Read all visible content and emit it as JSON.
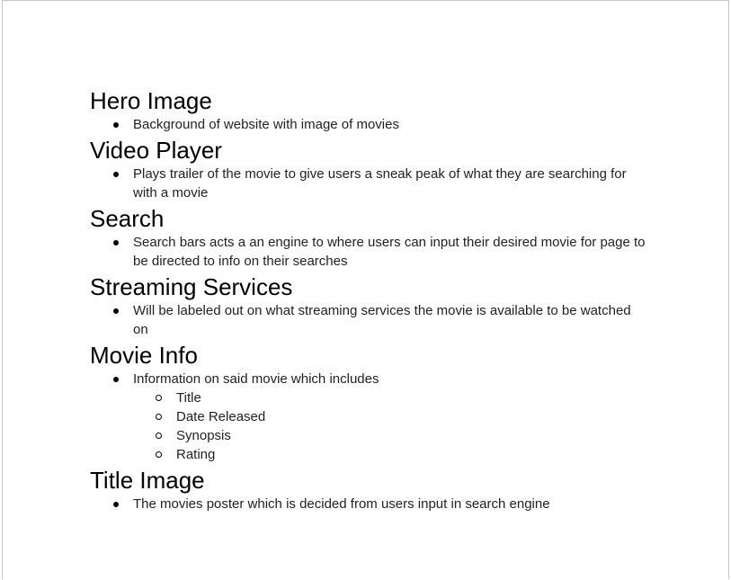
{
  "sections": [
    {
      "title": "Hero Image",
      "bullets": [
        "Background of website with image of movies"
      ]
    },
    {
      "title": "Video Player",
      "bullets": [
        "Plays trailer of the movie to give users a sneak peak of what they are searching for with a movie"
      ]
    },
    {
      "title": "Search",
      "bullets": [
        "Search bars acts a an engine to where users can input their desired movie for page to be directed to info on their searches"
      ]
    },
    {
      "title": "Streaming Services",
      "bullets": [
        "Will be labeled out on what streaming services the movie is available to be watched on"
      ]
    },
    {
      "title": "Movie Info",
      "bullets": [
        "Information on said movie which includes"
      ],
      "sub_bullets": [
        "Title",
        "Date Released",
        "Synopsis",
        "Rating"
      ]
    },
    {
      "title": "Title Image",
      "bullets": [
        "The movies poster which is decided from users input in search engine"
      ]
    }
  ]
}
